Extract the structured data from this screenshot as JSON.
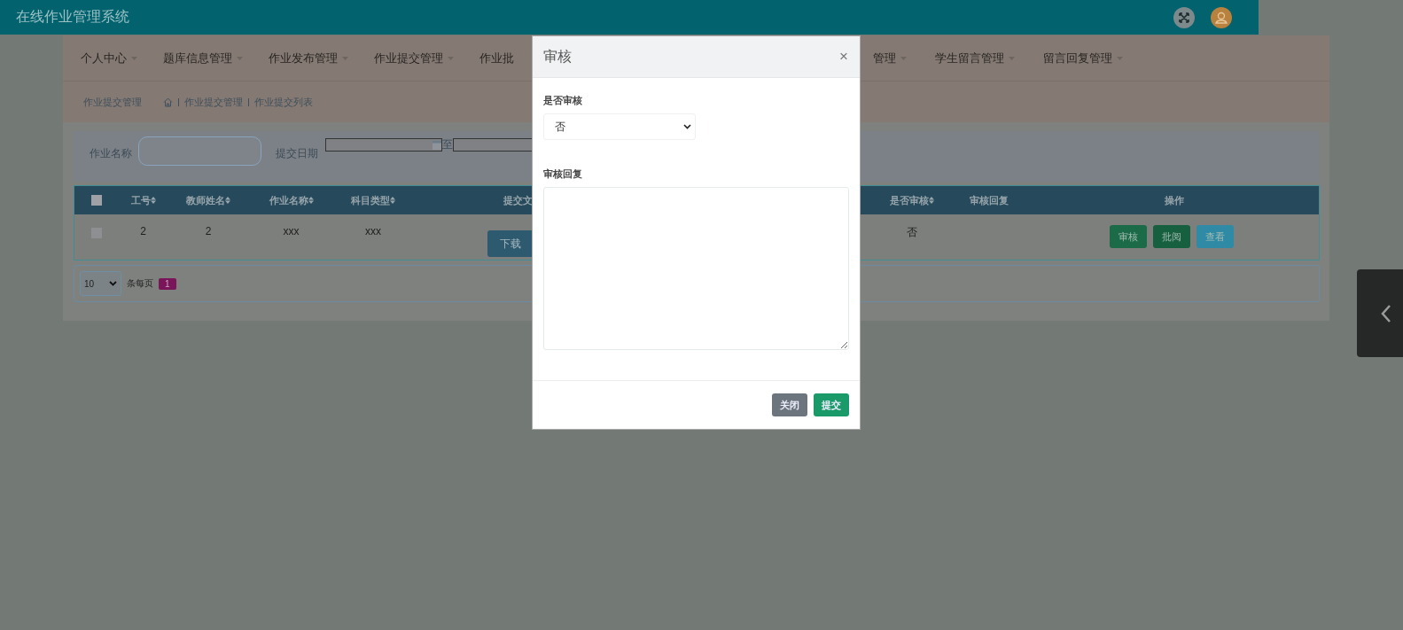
{
  "header": {
    "title": "在线作业管理系统"
  },
  "nav": {
    "left": [
      {
        "label": "个人中心",
        "caret": true
      },
      {
        "label": "题库信息管理",
        "caret": true
      },
      {
        "label": "作业发布管理",
        "caret": true
      },
      {
        "label": "作业提交管理",
        "caret": true
      },
      {
        "label": "作业批",
        "caret": false
      }
    ],
    "right": [
      {
        "label": "管理",
        "caret": true
      },
      {
        "label": "学生留言管理",
        "caret": true
      },
      {
        "label": "留言回复管理",
        "caret": true
      }
    ]
  },
  "breadcrumb": {
    "title": "作业提交管理",
    "items": [
      "作业提交管理",
      "作业提交列表"
    ]
  },
  "search": {
    "name_label": "作业名称",
    "date_label": "提交日期",
    "range_separator": "至"
  },
  "table": {
    "header_checked": false,
    "columns": [
      "工号",
      "教师姓名",
      "作业名称",
      "科目类型",
      "提交文",
      "是否审核",
      "审核回复",
      "操作"
    ],
    "sortable": [
      true,
      true,
      true,
      true,
      false,
      true,
      false,
      false
    ],
    "rows": [
      {
        "checked": false,
        "cells": [
          "2",
          "2",
          "xxx",
          "xxx"
        ],
        "file_button": "下载",
        "audited": "否",
        "reply": "",
        "actions": [
          {
            "label": "审核",
            "color": "#1c6b48"
          },
          {
            "label": "批阅",
            "color": "#17603f"
          },
          {
            "label": "查看",
            "color": "#2f8aa6"
          }
        ]
      }
    ]
  },
  "pager": {
    "page_size": "10",
    "per_page_label": "条每页",
    "pages": [
      {
        "label": "1",
        "selected": true
      }
    ]
  },
  "modal": {
    "title": "审核",
    "close": "×",
    "fields": [
      {
        "kind": "select",
        "label": "是否审核",
        "value": "否"
      },
      {
        "kind": "textarea",
        "label": "审核回复"
      }
    ],
    "buttons": [
      {
        "label": "关闭",
        "kind": "secondary"
      },
      {
        "label": "提交",
        "kind": "primary"
      }
    ]
  }
}
